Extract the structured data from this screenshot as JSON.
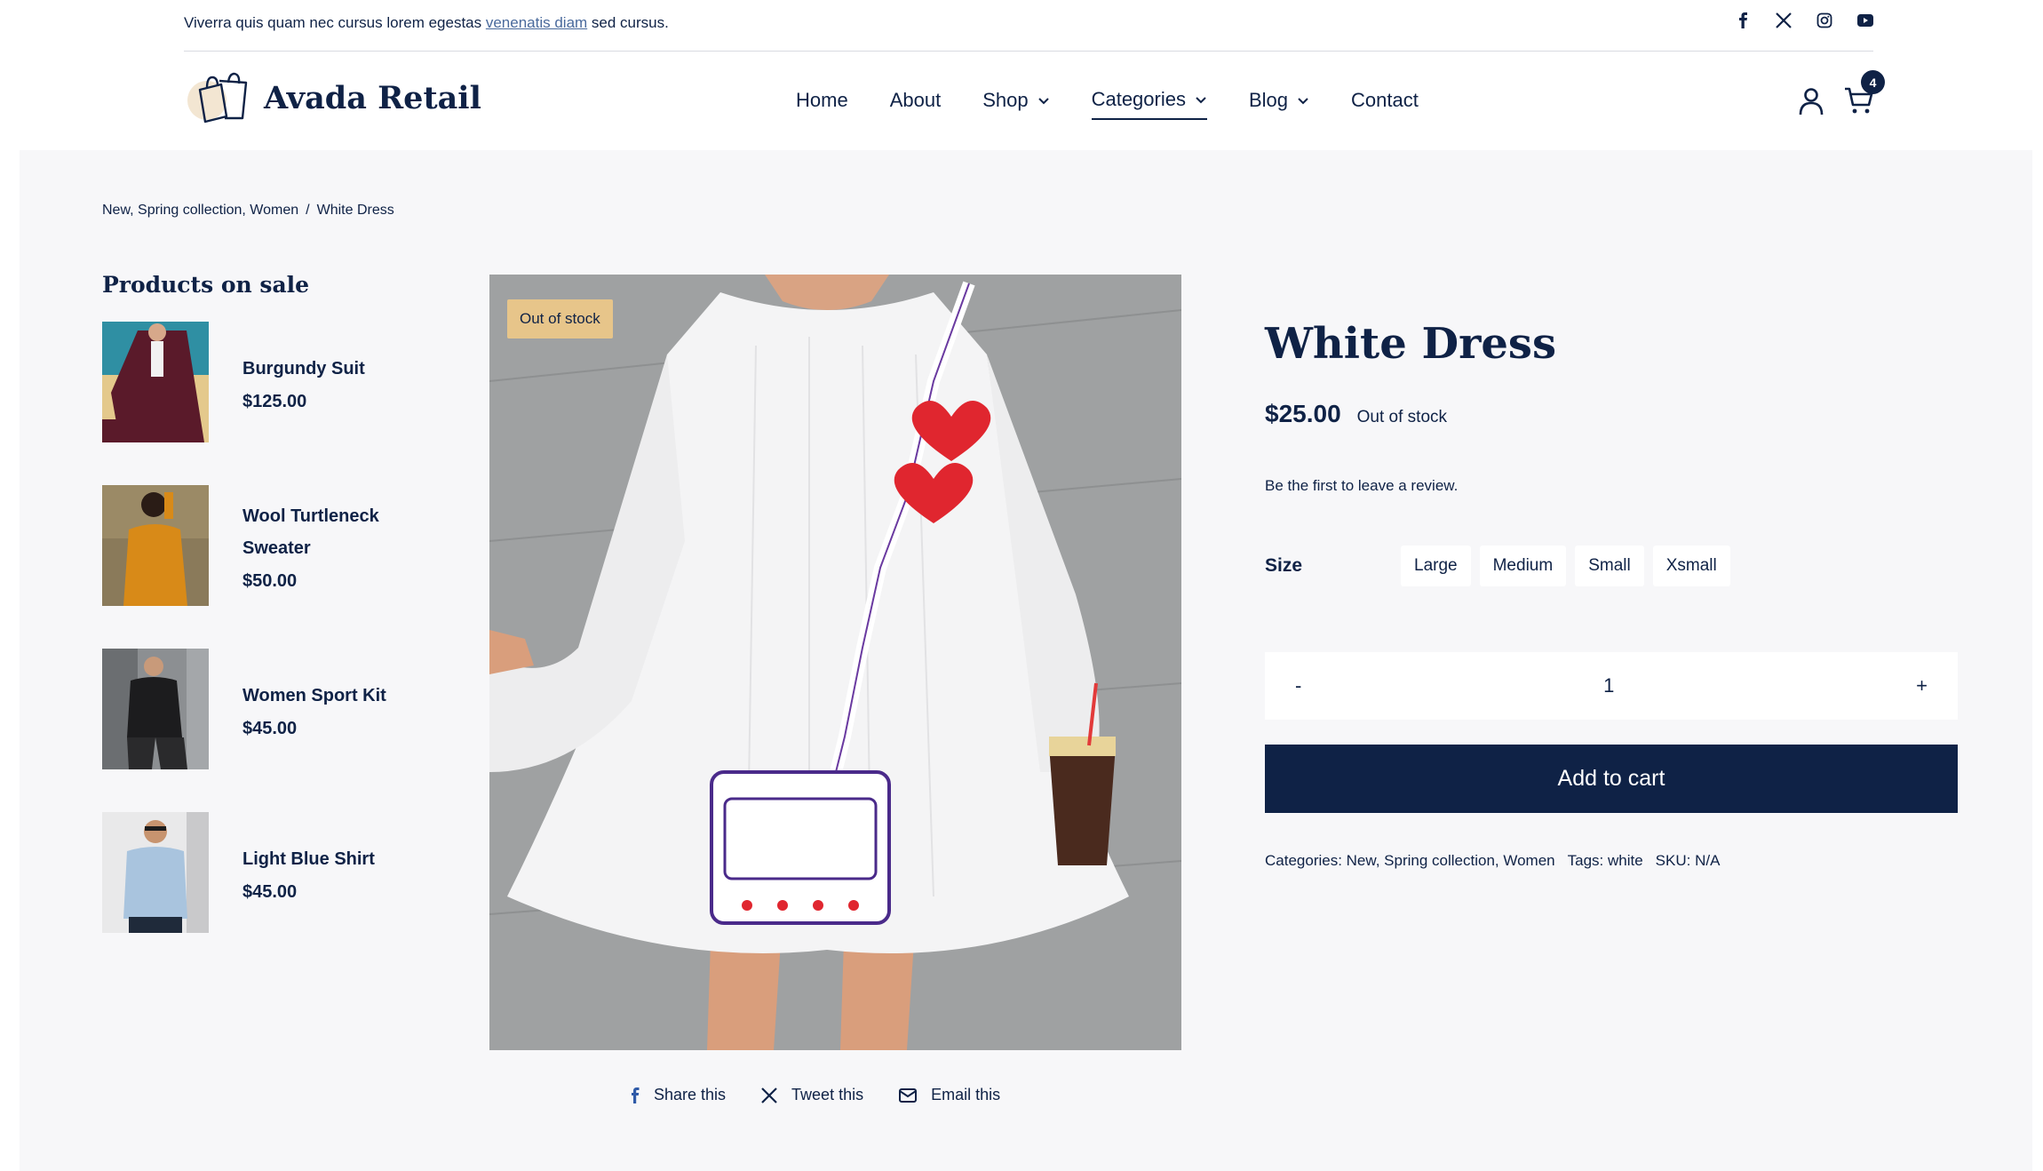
{
  "topbar": {
    "promo_before": "Viverra quis quam nec cursus lorem egestas ",
    "promo_link": "venenatis diam",
    "promo_after": " sed cursus."
  },
  "social": [
    "facebook-icon",
    "x-icon",
    "instagram-icon",
    "youtube-icon"
  ],
  "header": {
    "logo": "Avada Retail",
    "nav": [
      "Home",
      "About",
      "Shop",
      "Categories",
      "Blog",
      "Contact"
    ],
    "active_nav": "Categories",
    "cart_count": "4"
  },
  "breadcrumb": {
    "categories": "New, Spring collection, Women",
    "separator": "/",
    "current": "White Dress"
  },
  "sidebar": {
    "title": "Products on sale",
    "items": [
      {
        "name": "Burgundy Suit",
        "price": "$125.00"
      },
      {
        "name": "Wool Turtleneck Sweater",
        "price": "$50.00"
      },
      {
        "name": "Women Sport Kit",
        "price": "$45.00"
      },
      {
        "name": "Light Blue Shirt",
        "price": "$45.00"
      }
    ]
  },
  "product": {
    "badge": "Out of stock",
    "title": "White Dress",
    "price": "$25.00",
    "stock": "Out of stock",
    "review": "Be the first to leave a review.",
    "size_label": "Size",
    "sizes": [
      "Large",
      "Medium",
      "Small",
      "Xsmall"
    ],
    "qty_minus": "-",
    "qty_value": "1",
    "qty_plus": "+",
    "add_to_cart": "Add to cart",
    "meta_categories": "Categories: New, Spring collection, Women",
    "meta_tags": "Tags: white",
    "meta_sku": "SKU: N/A"
  },
  "share": {
    "facebook": "Share this",
    "twitter": "Tweet this",
    "email": "Email this"
  },
  "colors": {
    "navy": "#0f2246",
    "badge": "#e7c58a",
    "background": "#f7f7f9"
  }
}
